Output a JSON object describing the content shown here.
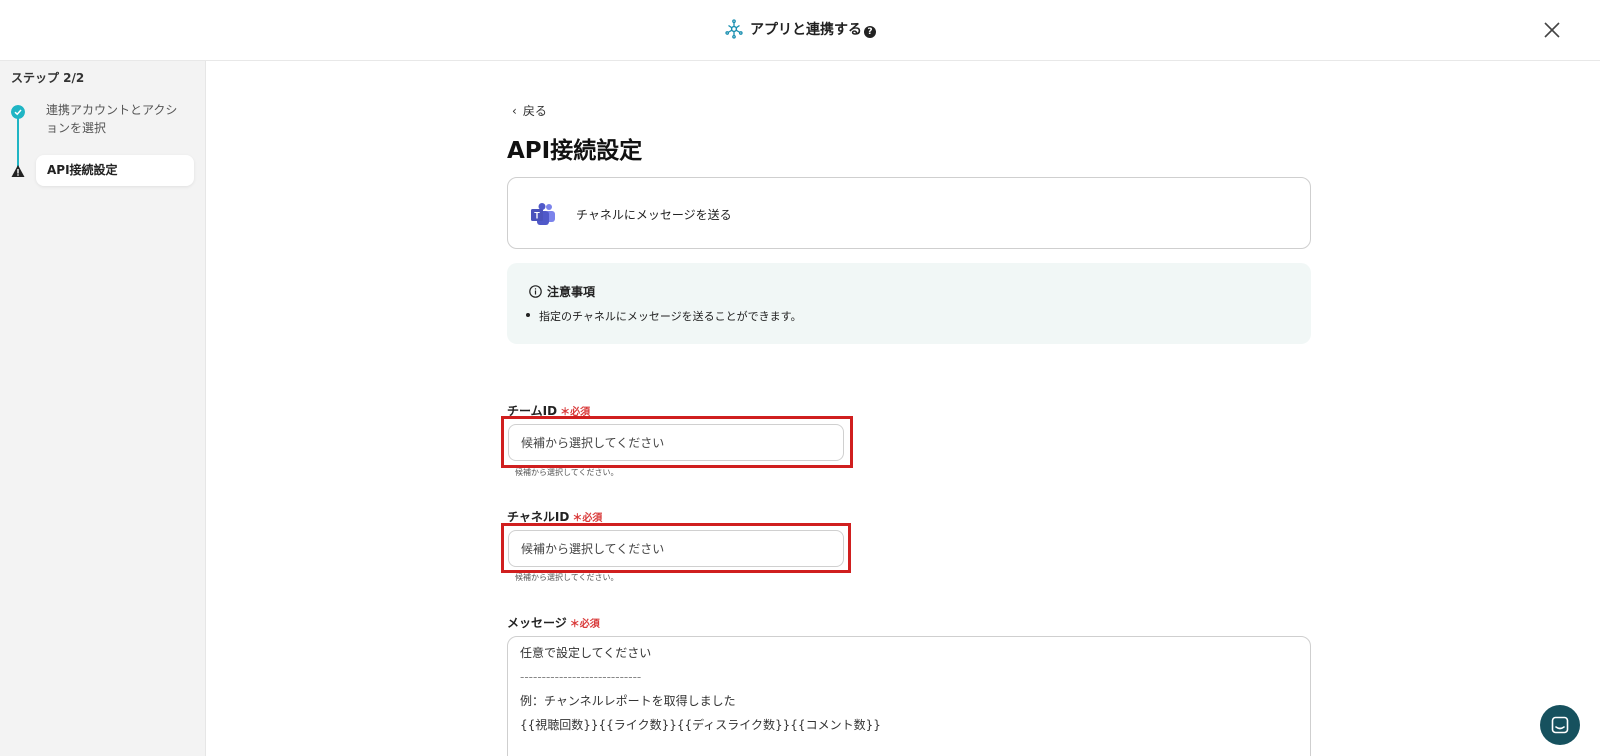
{
  "header": {
    "title": "アプリと連携する",
    "help_glyph": "?"
  },
  "sidebar": {
    "step_label": "ステップ 2/2",
    "steps": [
      {
        "label": "連携アカウントとアクションを選択",
        "status": "done"
      },
      {
        "label": "API接続設定",
        "status": "warning"
      }
    ]
  },
  "main": {
    "back_label": "戻る",
    "title": "API接続設定",
    "action": {
      "label": "チャネルにメッセージを送る",
      "icon": "teams-icon"
    },
    "notice": {
      "title": "注意事項",
      "items": [
        "指定のチャネルにメッセージを送ることができます。"
      ]
    },
    "fields": [
      {
        "label": "チームID",
        "required": "必須",
        "placeholder": "候補から選択してください",
        "hint": "候補から選択してください。"
      },
      {
        "label": "チャネルID",
        "required": "必須",
        "placeholder": "候補から選択してください",
        "hint": "候補から選択してください。"
      },
      {
        "label": "メッセージ",
        "required": "必須",
        "lines": [
          "任意で設定してください",
          "----------------------------",
          "例：チャンネルレポートを取得しました",
          "{{視聴回数}}{{ライク数}}{{ディスライク数}}{{コメント数}}"
        ]
      }
    ]
  },
  "colors": {
    "accent": "#1fb5c4",
    "required": "#d93a3a",
    "highlight": "#d01f1f",
    "chat": "#16515e"
  }
}
